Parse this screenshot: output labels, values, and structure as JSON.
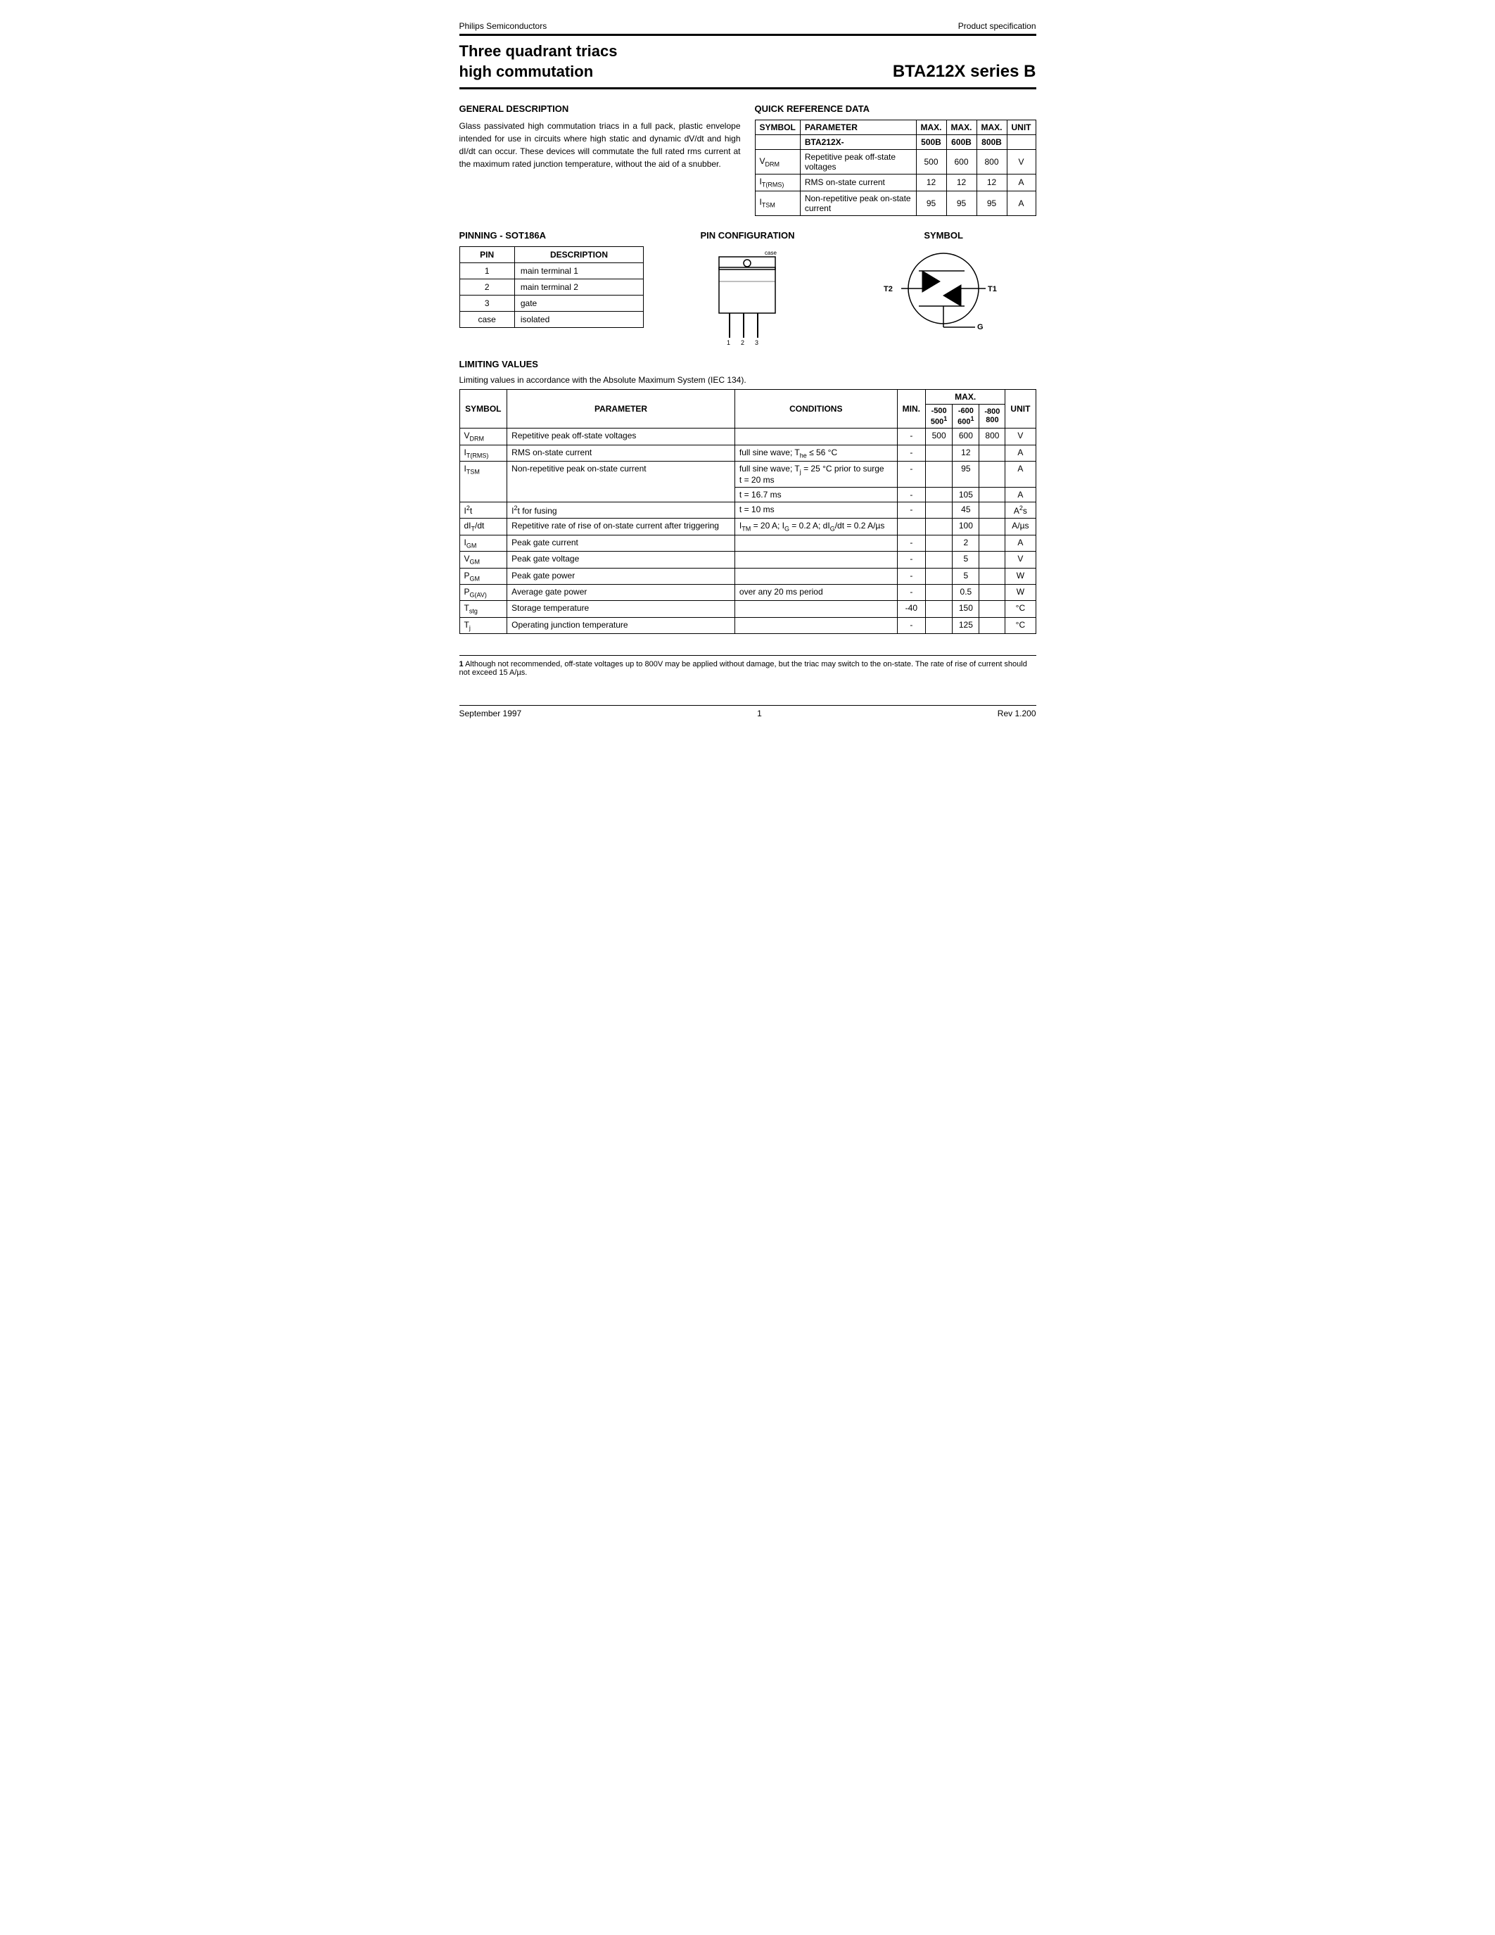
{
  "header": {
    "company": "Philips Semiconductors",
    "doc_type": "Product specification"
  },
  "title": {
    "left_line1": "Three quadrant triacs",
    "left_line2": "high commutation",
    "right": "BTA212X series B"
  },
  "general_description": {
    "heading": "GENERAL DESCRIPTION",
    "text": "Glass passivated high commutation triacs in a full pack, plastic envelope intended for use in circuits where high static and dynamic dV/dt and high dI/dt can occur. These devices will commutate the full rated rms current at the maximum rated junction temperature, without the aid of a snubber."
  },
  "quick_reference": {
    "heading": "QUICK REFERENCE DATA",
    "columns": [
      "SYMBOL",
      "PARAMETER",
      "MAX.",
      "MAX.",
      "MAX.",
      "UNIT"
    ],
    "subheader": [
      "",
      "BTA212X-",
      "500B",
      "600B",
      "800B",
      ""
    ],
    "rows": [
      [
        "V_DRM",
        "Repetitive peak off-state voltages",
        "500",
        "600",
        "800",
        "V"
      ],
      [
        "I_T(RMS)",
        "RMS on-state current",
        "12",
        "12",
        "12",
        "A"
      ],
      [
        "I_TSM",
        "Non-repetitive peak on-state current",
        "95",
        "95",
        "95",
        "A"
      ]
    ]
  },
  "pinning": {
    "heading": "PINNING - SOT186A",
    "columns": [
      "PIN",
      "DESCRIPTION"
    ],
    "rows": [
      [
        "1",
        "main terminal 1"
      ],
      [
        "2",
        "main terminal 2"
      ],
      [
        "3",
        "gate"
      ],
      [
        "case",
        "isolated"
      ]
    ]
  },
  "pin_config": {
    "heading": "PIN CONFIGURATION"
  },
  "symbol_section": {
    "heading": "SYMBOL",
    "labels": {
      "T2": "T2",
      "T1": "T1",
      "G": "G"
    }
  },
  "limiting_values": {
    "heading": "LIMITING VALUES",
    "subtitle": "Limiting values in accordance with the Absolute Maximum System (IEC 134).",
    "columns": [
      "SYMBOL",
      "PARAMETER",
      "CONDITIONS",
      "MIN.",
      "MAX.",
      "MAX.",
      "MAX.",
      "UNIT"
    ],
    "max_sub": [
      "-500\n500¹",
      "-600\n600¹",
      "-800\n800"
    ],
    "rows": [
      {
        "symbol": "V_DRM",
        "parameter": "Repetitive peak off-state voltages",
        "conditions": "",
        "min": "-",
        "max500": "-500\n500¹",
        "max600": "-600\n600¹",
        "max800": "-800\n800",
        "unit": "V"
      },
      {
        "symbol": "I_T(RMS)",
        "parameter": "RMS on-state current",
        "conditions": "full sine wave; T_he ≤ 56 °C",
        "min": "-",
        "max500": "",
        "max600": "12",
        "max800": "",
        "unit": "A"
      },
      {
        "symbol": "I_TSM",
        "parameter": "Non-repetitive peak on-state current",
        "conditions": "full sine wave; T_j = 25 °C prior to surge",
        "min": "",
        "max500": "",
        "max600": "",
        "max800": "",
        "unit": ""
      },
      {
        "symbol": "",
        "parameter": "",
        "conditions": "t = 20 ms",
        "min": "-",
        "max600": "95",
        "unit": "A"
      },
      {
        "symbol": "",
        "parameter": "",
        "conditions": "t = 16.7 ms",
        "min": "-",
        "max600": "105",
        "unit": "A"
      },
      {
        "symbol": "I²t",
        "parameter": "I²t for fusing",
        "conditions": "t = 10 ms",
        "min": "-",
        "max600": "45",
        "unit": "A²s"
      },
      {
        "symbol": "dI_T/dt",
        "parameter": "Repetitive rate of rise of on-state current after triggering",
        "conditions": "I_TM = 20 A; I_G = 0.2 A; dI_G/dt = 0.2 A/µs",
        "min": "",
        "max600": "100",
        "unit": "A/µs"
      },
      {
        "symbol": "I_GM",
        "parameter": "Peak gate current",
        "conditions": "",
        "min": "-",
        "max600": "2",
        "unit": "A"
      },
      {
        "symbol": "V_GM",
        "parameter": "Peak gate voltage",
        "conditions": "",
        "min": "-",
        "max600": "5",
        "unit": "V"
      },
      {
        "symbol": "P_GM",
        "parameter": "Peak gate power",
        "conditions": "",
        "min": "-",
        "max600": "5",
        "unit": "W"
      },
      {
        "symbol": "P_G(AV)",
        "parameter": "Average gate power",
        "conditions": "over any 20 ms period",
        "min": "-",
        "max600": "0.5",
        "unit": "W"
      },
      {
        "symbol": "T_stg",
        "parameter": "Storage temperature",
        "conditions": "",
        "min": "-40",
        "max600": "150",
        "unit": "°C"
      },
      {
        "symbol": "T_j",
        "parameter": "Operating junction temperature",
        "conditions": "",
        "min": "-",
        "max600": "125",
        "unit": "°C"
      }
    ]
  },
  "footnote": {
    "number": "1",
    "text": "Although not recommended, off-state voltages up to 800V may be applied without damage, but the triac may switch to the on-state. The rate of rise of current should not exceed 15 A/µs."
  },
  "footer": {
    "date": "September 1997",
    "page": "1",
    "rev": "Rev 1.200"
  }
}
